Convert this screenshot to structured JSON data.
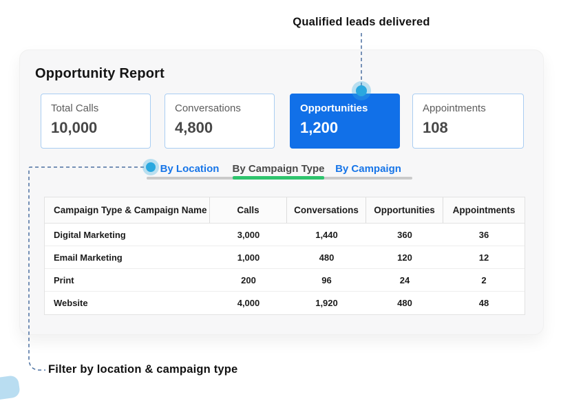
{
  "annotations": {
    "qualified_leads": "Qualified leads delivered",
    "filter_note": "Filter by location & campaign type"
  },
  "report": {
    "title": "Opportunity Report",
    "stat_cards": [
      {
        "label": "Total Calls",
        "value": "10,000",
        "highlighted": false
      },
      {
        "label": "Conversations",
        "value": "4,800",
        "highlighted": false
      },
      {
        "label": "Opportunities",
        "value": "1,200",
        "highlighted": true
      },
      {
        "label": "Appointments",
        "value": "108",
        "highlighted": false
      }
    ],
    "tabs": [
      {
        "label": "By Location",
        "active": false
      },
      {
        "label": "By Campaign Type",
        "active": true
      },
      {
        "label": "By Campaign",
        "active": false
      }
    ],
    "table": {
      "columns": [
        "Campaign Type & Campaign Name",
        "Calls",
        "Conversations",
        "Opportunities",
        "Appointments"
      ],
      "rows": [
        [
          "Digital Marketing",
          "3,000",
          "1,440",
          "360",
          "36"
        ],
        [
          "Email Marketing",
          "1,000",
          "480",
          "120",
          "12"
        ],
        [
          "Print",
          "200",
          "96",
          "24",
          "2"
        ],
        [
          "Website",
          "4,000",
          "1,920",
          "480",
          "48"
        ]
      ]
    }
  },
  "colors": {
    "accent_blue": "#1170E8",
    "tab_link_blue": "#1775E8",
    "active_tab_green": "#2EC46D",
    "marker_cyan": "#2AA8DF",
    "connector_blue": "#4A6FA0",
    "card_border": "#A9CDF2",
    "panel_bg": "#F7F7F8"
  }
}
